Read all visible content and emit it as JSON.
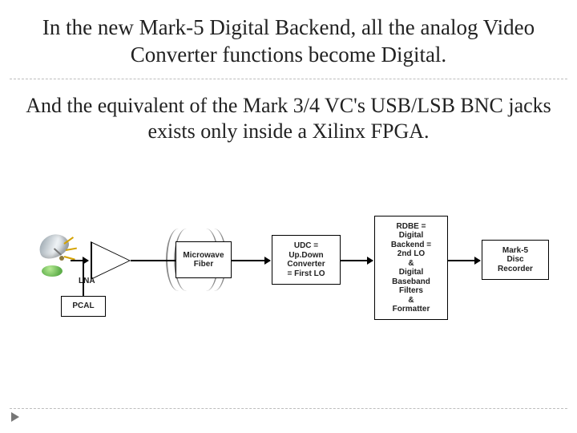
{
  "title": "In the new Mark-5 Digital Backend, all the analog Video Converter functions become Digital.",
  "subtitle": "And the equivalent of the Mark 3/4 VC's USB/LSB BNC jacks exists only inside a Xilinx FPGA.",
  "diagram": {
    "antenna": "antenna-icon",
    "lna": "LNA",
    "pcal": "PCAL",
    "fiber": "Microwave\nFiber",
    "udc": "UDC =\nUp.Down\nConverter\n= First LO",
    "rdbe": "RDBE =\nDigital\nBackend =\n2nd LO\n&\nDigital\nBaseband\nFilters\n&\nFormatter",
    "recorder": "Mark-5\nDisc\nRecorder"
  }
}
